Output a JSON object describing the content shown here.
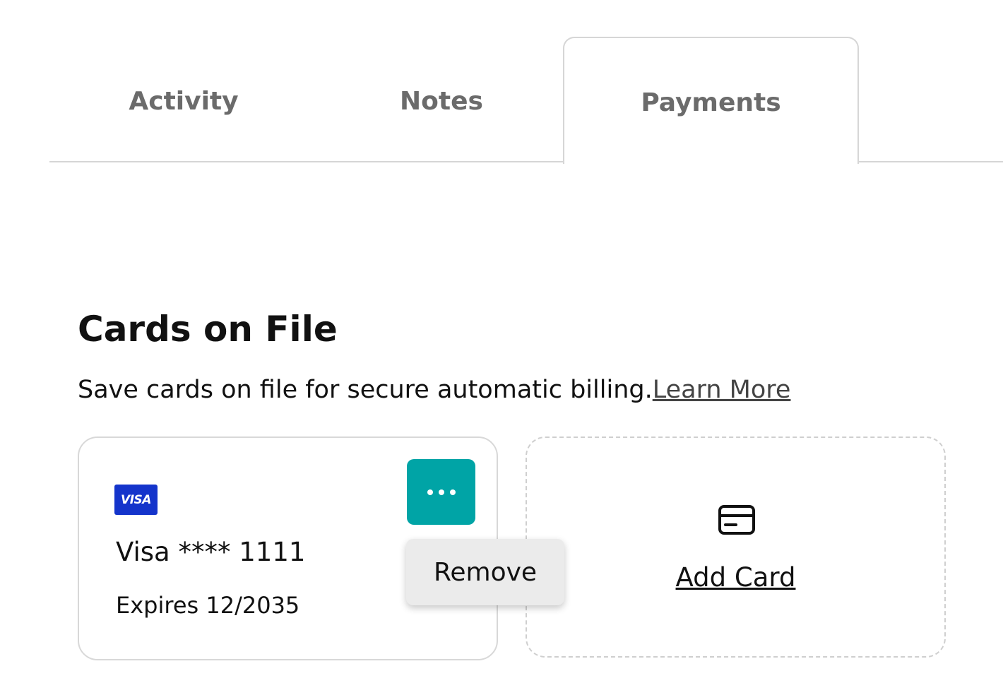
{
  "tabs": [
    {
      "label": "Activity",
      "active": false
    },
    {
      "label": "Notes",
      "active": false
    },
    {
      "label": "Payments",
      "active": true
    }
  ],
  "section": {
    "title": "Cards on File",
    "description": "Save cards on file for secure automatic billing.",
    "learn_more": "Learn More"
  },
  "card": {
    "brand_logo": "VISA",
    "name": "Visa **** 1111",
    "expiry": "Expires 12/2035",
    "menu_icon": "more-horizontal-icon"
  },
  "menu": {
    "items": [
      "Remove"
    ]
  },
  "add_card": {
    "label": "Add Card",
    "icon": "credit-card-icon"
  },
  "colors": {
    "accent": "#00a4a6",
    "visa_blue": "#1434cb",
    "tab_text": "#6b6b6b",
    "border": "#d6d6d6"
  }
}
